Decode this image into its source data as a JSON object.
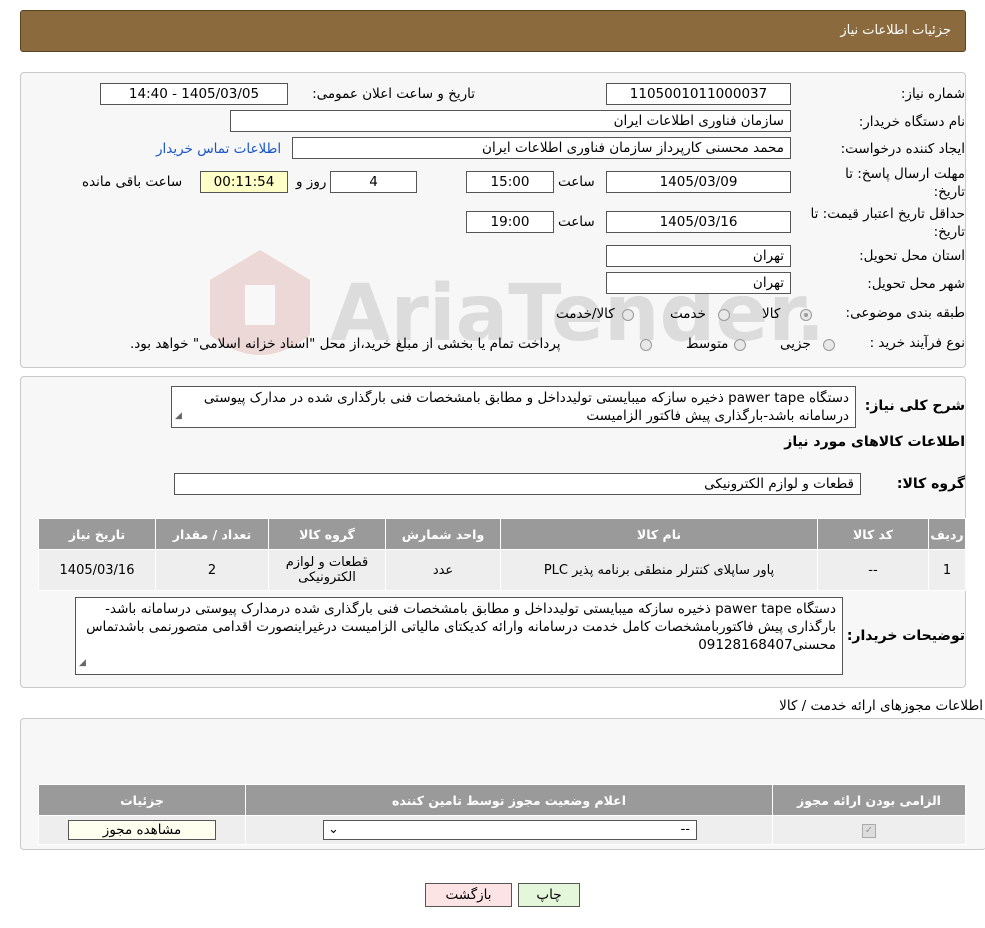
{
  "header": {
    "title": "جزئیات اطلاعات نیاز"
  },
  "watermark": {
    "text": "AriaTender.neT"
  },
  "need": {
    "number_label": "شماره نیاز:",
    "number_value": "1105001011000037",
    "announce_label": "تاریخ و ساعت اعلان عمومی:",
    "announce_value": "1405/03/05 - 14:40",
    "buyer_label": "نام دستگاه خریدار:",
    "buyer_value": "سازمان فناوری اطلاعات ایران",
    "creator_label": "ایجاد کننده درخواست:",
    "creator_value": "محمد محسنی کارپرداز سازمان فناوری اطلاعات ایران",
    "contact_link": "اطلاعات تماس خریدار",
    "deadline_label_1": "مهلت ارسال پاسخ: تا",
    "deadline_label_2": "تاریخ:",
    "deadline_date": "1405/03/09",
    "time_label": "ساعت",
    "deadline_time": "15:00",
    "days_value": "4",
    "days_label": "روز و",
    "remaining_value": "00:11:54",
    "remaining_label": "ساعت باقی مانده",
    "validity_label_1": "حداقل تاریخ اعتبار قیمت: تا",
    "validity_label_2": "تاریخ:",
    "validity_date": "1405/03/16",
    "validity_time": "19:00",
    "province_label": "استان محل تحویل:",
    "province_value": "تهران",
    "city_label": "شهر محل تحویل:",
    "city_value": "تهران",
    "category_label": "طبقه بندی موضوعی:",
    "category_options": [
      "کالا",
      "خدمت",
      "کالا/خدمت"
    ],
    "purchase_label": "نوع فرآیند خرید :",
    "purchase_options": [
      "جزیی",
      "متوسط"
    ],
    "purchase_note": "پرداخت تمام یا بخشی از مبلغ خرید،از محل \"اسناد خزانه اسلامی\" خواهد بود."
  },
  "description": {
    "label": "شرح کلی نیاز:",
    "text": "دستگاه  pawer tape ذخیره سازکه میبایستی تولیدداخل و مطابق بامشخصات فنی بارگذاری شده در مدارک پیوستی درسامانه باشد-بارگذاری پیش فاکتور الزامیست"
  },
  "goods": {
    "section_title": "اطلاعات کالاهای مورد نیاز",
    "group_label": "گروه کالا:",
    "group_value": "قطعات و لوازم الکترونیکی",
    "columns": [
      "ردیف",
      "کد کالا",
      "نام کالا",
      "واحد شمارش",
      "گروه کالا",
      "تعداد / مقدار",
      "تاریخ نیاز"
    ],
    "rows": [
      [
        "1",
        "--",
        "پاور ساپلای کنترلر منطقی برنامه پذیر PLC",
        "عدد",
        "قطعات و لوازم الکترونیکی",
        "2",
        "1405/03/16"
      ]
    ]
  },
  "buyer_notes": {
    "label": "توضیحات خریدار:",
    "text": "دستگاه pawer tape ذخیره سازکه میبایستی تولیدداخل و مطابق بامشخصات فنی بارگذاری شده درمدارک پیوستی درسامانه باشد-بارگذاری پیش فاکتوربامشخصات کامل خدمت درسامانه وارائه کدیکتای مالیاتی الزامیست درغیراینصورت اقدامی متصورنمی باشدتماس محسنی09128168407"
  },
  "permits": {
    "title": "اطلاعات مجوزهای ارائه خدمت / کالا",
    "columns": [
      "الزامی بودن ارائه مجوز",
      "اعلام وضعیت مجوز توسط تامین کننده",
      "جزئیات"
    ],
    "select_value": "--",
    "view_button": "مشاهده مجوز"
  },
  "actions": {
    "print": "چاپ",
    "back": "بازگشت"
  }
}
